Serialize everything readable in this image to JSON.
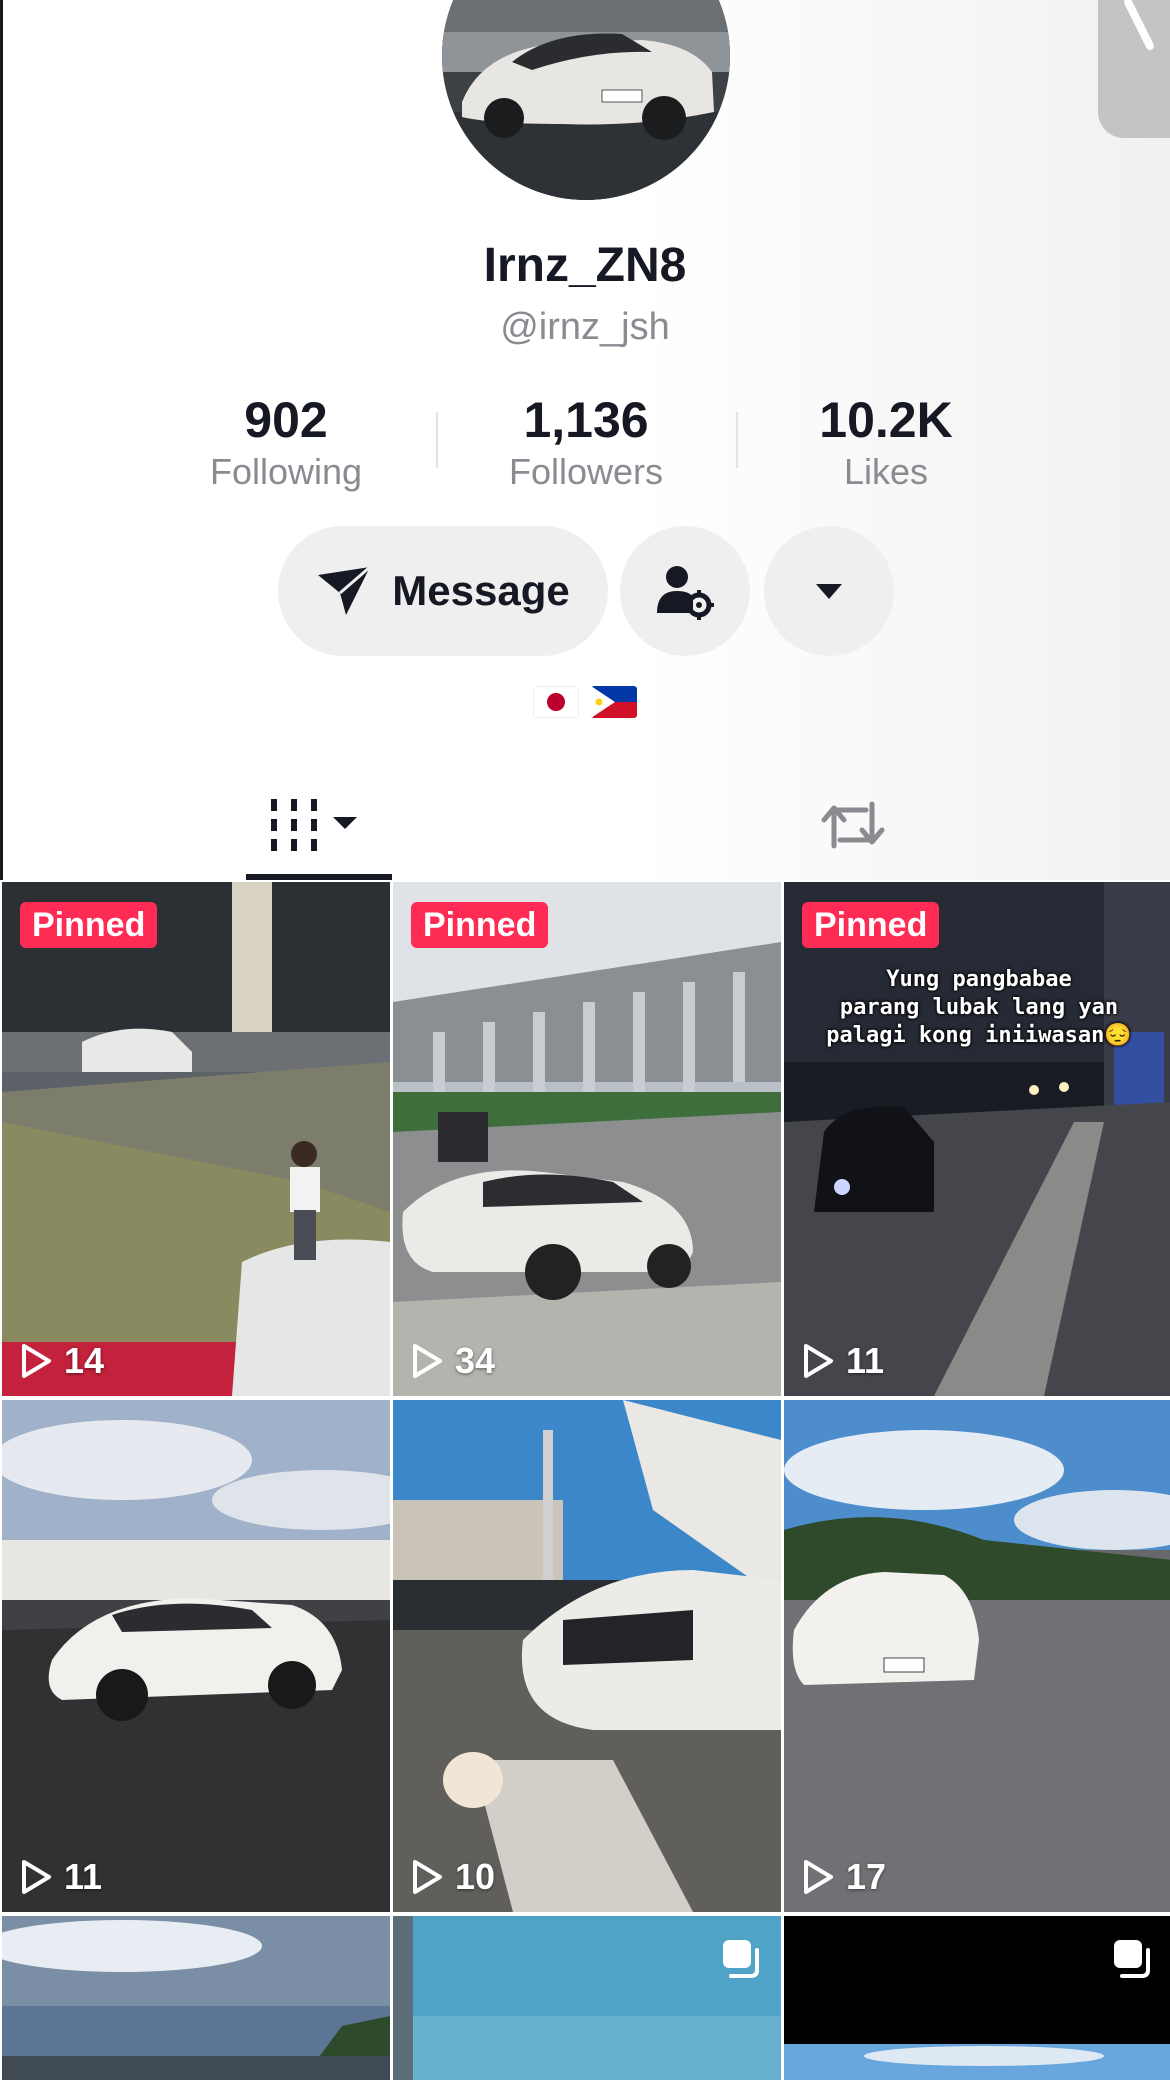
{
  "profile": {
    "display_name": "Irnz_ZN8",
    "handle": "@irnz_jsh",
    "stats": [
      {
        "value": "902",
        "label": "Following"
      },
      {
        "value": "1,136",
        "label": "Followers"
      },
      {
        "value": "10.2K",
        "label": "Likes"
      }
    ],
    "message_label": "Message",
    "flags": [
      "japan-flag",
      "philippines-flag"
    ]
  },
  "tabs": [
    {
      "name": "videos",
      "icon": "videos-grid-icon",
      "active": true
    },
    {
      "name": "reposts",
      "icon": "repost-icon",
      "active": false
    }
  ],
  "videos": [
    {
      "pinned_label": "Pinned",
      "views": "14",
      "caption": ""
    },
    {
      "pinned_label": "Pinned",
      "views": "34",
      "caption": ""
    },
    {
      "pinned_label": "Pinned",
      "views": "11",
      "caption": "Yung pangbabae\nparang lubak lang yan\npalagi kong iniiwasan😔"
    },
    {
      "pinned_label": "",
      "views": "11",
      "caption": ""
    },
    {
      "pinned_label": "",
      "views": "10",
      "caption": ""
    },
    {
      "pinned_label": "",
      "views": "17",
      "caption": ""
    },
    {
      "pinned_label": "",
      "views": "",
      "caption": ""
    },
    {
      "pinned_label": "",
      "views": "",
      "caption": "",
      "multi": true
    },
    {
      "pinned_label": "",
      "views": "",
      "caption": "",
      "multi": true
    }
  ],
  "colors": {
    "pinned_badge": "#fe2c55",
    "text_primary": "#161823",
    "text_secondary": "#8a8b91",
    "button_bg": "#efefef"
  }
}
